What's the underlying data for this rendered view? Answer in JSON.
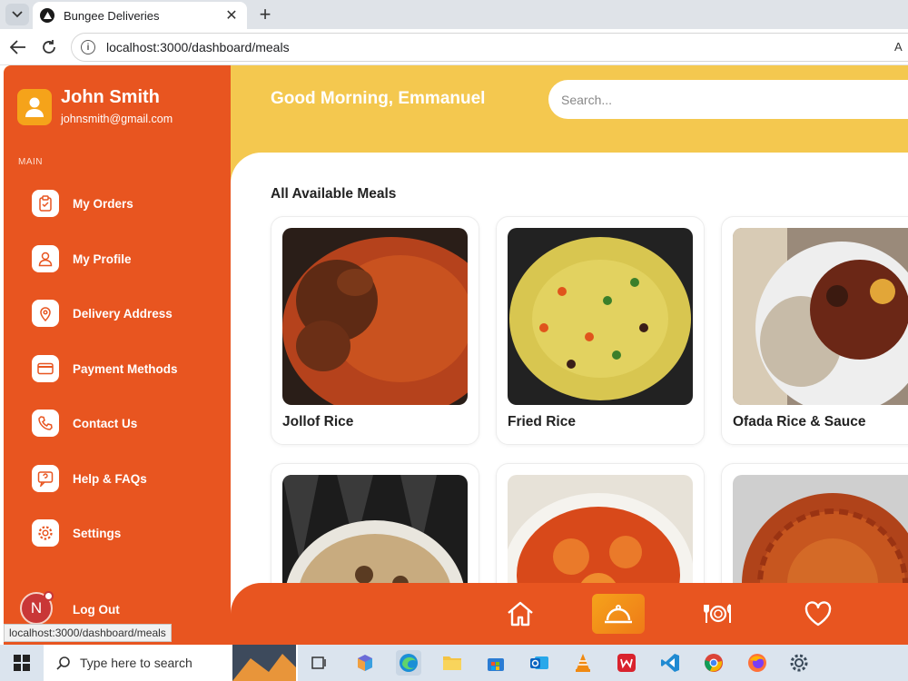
{
  "browser": {
    "tab_title": "Bungee Deliveries",
    "url": "localhost:3000/dashboard/meals",
    "toolbar_right_text": "A"
  },
  "sidebar": {
    "user_name": "John Smith",
    "user_email": "johnsmith@gmail.com",
    "section_label": "MAIN",
    "items": [
      {
        "label": "My Orders",
        "icon": "clipboard-check-icon"
      },
      {
        "label": "My Profile",
        "icon": "user-icon"
      },
      {
        "label": "Delivery Address",
        "icon": "map-pin-icon"
      },
      {
        "label": "Payment Methods",
        "icon": "credit-card-icon"
      },
      {
        "label": "Contact Us",
        "icon": "phone-icon"
      },
      {
        "label": "Help & FAQs",
        "icon": "help-chat-icon"
      },
      {
        "label": "Settings",
        "icon": "gear-icon"
      }
    ],
    "logout_label": "Log Out",
    "logout_avatar_letter": "N"
  },
  "header": {
    "greeting": "Good Morning, Emmanuel",
    "search_placeholder": "Search..."
  },
  "main": {
    "section_title": "All Available Meals",
    "meals": [
      {
        "name": "Jollof Rice"
      },
      {
        "name": "Fried Rice"
      },
      {
        "name": "Ofada Rice & Sauce"
      },
      {
        "name": ""
      },
      {
        "name": ""
      },
      {
        "name": ""
      }
    ]
  },
  "bottom_nav": {
    "items": [
      {
        "icon": "home-icon",
        "active": false
      },
      {
        "icon": "food-cloche-icon",
        "active": true
      },
      {
        "icon": "plate-cutlery-icon",
        "active": false
      },
      {
        "icon": "heart-icon",
        "active": false
      }
    ]
  },
  "status_bar": {
    "hover_url": "localhost:3000/dashboard/meals"
  },
  "taskbar": {
    "search_placeholder": "Type here to search"
  },
  "colors": {
    "sidebar": "#e85520",
    "header": "#f4c84f",
    "accent": "#f5a31a"
  }
}
